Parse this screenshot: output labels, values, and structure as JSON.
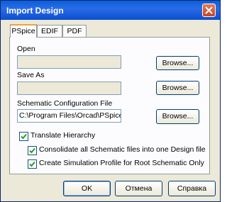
{
  "window": {
    "title": "Import Design",
    "close_icon": "close-icon"
  },
  "tabs": [
    {
      "label": "PSpice",
      "active": true
    },
    {
      "label": "EDIF",
      "active": false
    },
    {
      "label": "PDF",
      "active": false
    }
  ],
  "open": {
    "label": "Open",
    "value": "",
    "browse_label": "Browse..."
  },
  "save_as": {
    "label": "Save As",
    "value": "",
    "browse_label": "Browse..."
  },
  "schematic_config": {
    "label": "Schematic Configuration File",
    "value": "C:\\Program Files\\Orcad\\PSpice\\",
    "browse_label": "Browse..."
  },
  "options": {
    "translate_hierarchy": {
      "label": "Translate Hierarchy",
      "checked": true
    },
    "consolidate": {
      "label": "Consolidate all Schematic files into one Design file",
      "checked": true
    },
    "simulation_profile": {
      "label": "Create Simulation Profile for Root Schematic Only",
      "checked": true
    }
  },
  "footer": {
    "ok_label": "OK",
    "cancel_label": "Отмена",
    "help_label": "Справка"
  }
}
